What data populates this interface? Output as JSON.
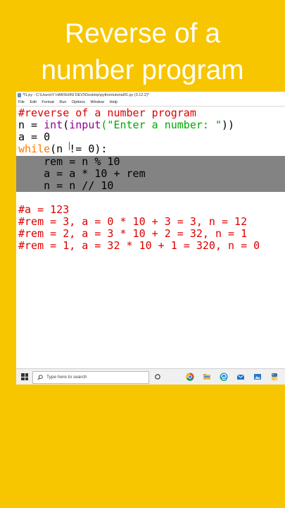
{
  "headline": {
    "line1": "Reverse of a",
    "line2": "number program"
  },
  "window": {
    "title": "*f1.py - C:\\Users\\Y HARSHINI DEVI\\Desktop\\pythontutorial\\f1.py (3.12.2)*"
  },
  "menu": [
    "File",
    "Edit",
    "Format",
    "Run",
    "Options",
    "Window",
    "Help"
  ],
  "code": {
    "l1": "#reverse of a number program",
    "l2_pre": "n = ",
    "l2_int": "int",
    "l2_paren": "(",
    "l2_input": "input",
    "l2_str": "(\"Enter a number: \"",
    "l2_end": "))",
    "l3": "a = 0",
    "l4_kw": "while",
    "l4_rest": "(n != 0):",
    "l5": "    rem = n % 10",
    "l6": "    a = a * 10 + rem",
    "l7": "    n = n // 10",
    "l9": "#a = 123",
    "l10": "#rem = 3, a = 0 * 10 + 3 = 3, n = 12",
    "l11": "#rem = 2, a = 3 * 10 + 2 = 32, n = 1",
    "l12": "#rem = 1, a = 32 * 10 + 1 = 320, n = 0"
  },
  "taskbar": {
    "search_placeholder": "Type here to search",
    "icons": [
      "task-view-icon",
      "chrome-icon",
      "file-explorer-icon",
      "edge-icon",
      "mail-icon",
      "photos-icon",
      "python-idle-icon"
    ]
  },
  "colors": {
    "background": "#f7c600",
    "keyword": "#ff7700",
    "builtin": "#900090",
    "string": "#00aa00",
    "comment": "#dd0000",
    "selection": "#838383"
  }
}
